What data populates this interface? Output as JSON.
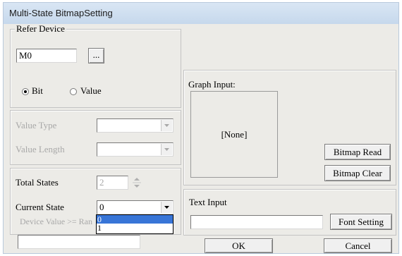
{
  "window": {
    "title": "Multi-State BitmapSetting"
  },
  "refer_device": {
    "legend": "Refer Device",
    "device_value": "M0",
    "browse_label": "...",
    "radio_bit": "Bit",
    "radio_value": "Value",
    "selected": "Bit"
  },
  "value_settings": {
    "value_type_label": "Value Type",
    "value_length_label": "Value Length",
    "value_type": "",
    "value_length": ""
  },
  "states": {
    "total_states_label": "Total States",
    "total_states": "2",
    "current_state_label": "Current State",
    "current_state": "0",
    "current_state_options": [
      "0",
      "1"
    ],
    "highlighted_option": "0",
    "device_value_label": "Device Value >= Ran",
    "device_value": ""
  },
  "graph_input": {
    "legend": "Graph Input:",
    "preview_text": "[None]",
    "read_label": "Bitmap Read",
    "clear_label": "Bitmap Clear"
  },
  "text_input": {
    "legend": "Text Input",
    "value": "",
    "font_setting_label": "Font Setting"
  },
  "footer": {
    "ok_label": "OK",
    "cancel_label": "Cancel"
  }
}
